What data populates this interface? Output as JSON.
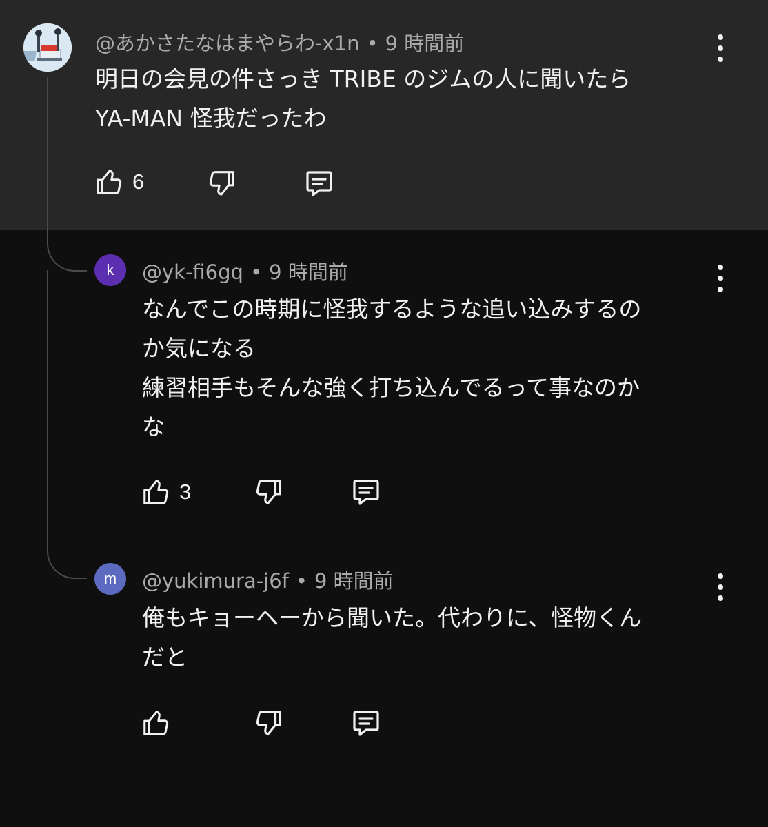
{
  "comments": [
    {
      "handle": "@あかさたなはまやらわ-x1n",
      "time": "9 時間前",
      "text": "明日の会見の件さっき TRIBE のジムの人に聞いたら\nYA-MAN 怪我だったわ",
      "likes": "6"
    },
    {
      "handle": "@yk-fi6gq",
      "time": "9 時間前",
      "avatar_letter": "k",
      "avatar_color": "#5b2fb0",
      "text": "なんでこの時期に怪我するような追い込みするの\nか気になる\n練習相手もそんな強く打ち込んでるって事なのか\nな",
      "likes": "3"
    },
    {
      "handle": "@yukimura-j6f",
      "time": "9 時間前",
      "avatar_letter": "m",
      "avatar_color": "#5c6bc0",
      "text": "俺もキョーヘーから聞いた。代わりに、怪物くん\nだと",
      "likes": ""
    }
  ],
  "separator": "•",
  "colors": {
    "parent_bg": "#272727",
    "page_bg": "#0f0f0f",
    "meta_text": "#aaaaaa",
    "body_text": "#f1f1f1"
  },
  "icons": [
    "like-icon",
    "dislike-icon",
    "reply-icon",
    "more-vert-icon"
  ]
}
